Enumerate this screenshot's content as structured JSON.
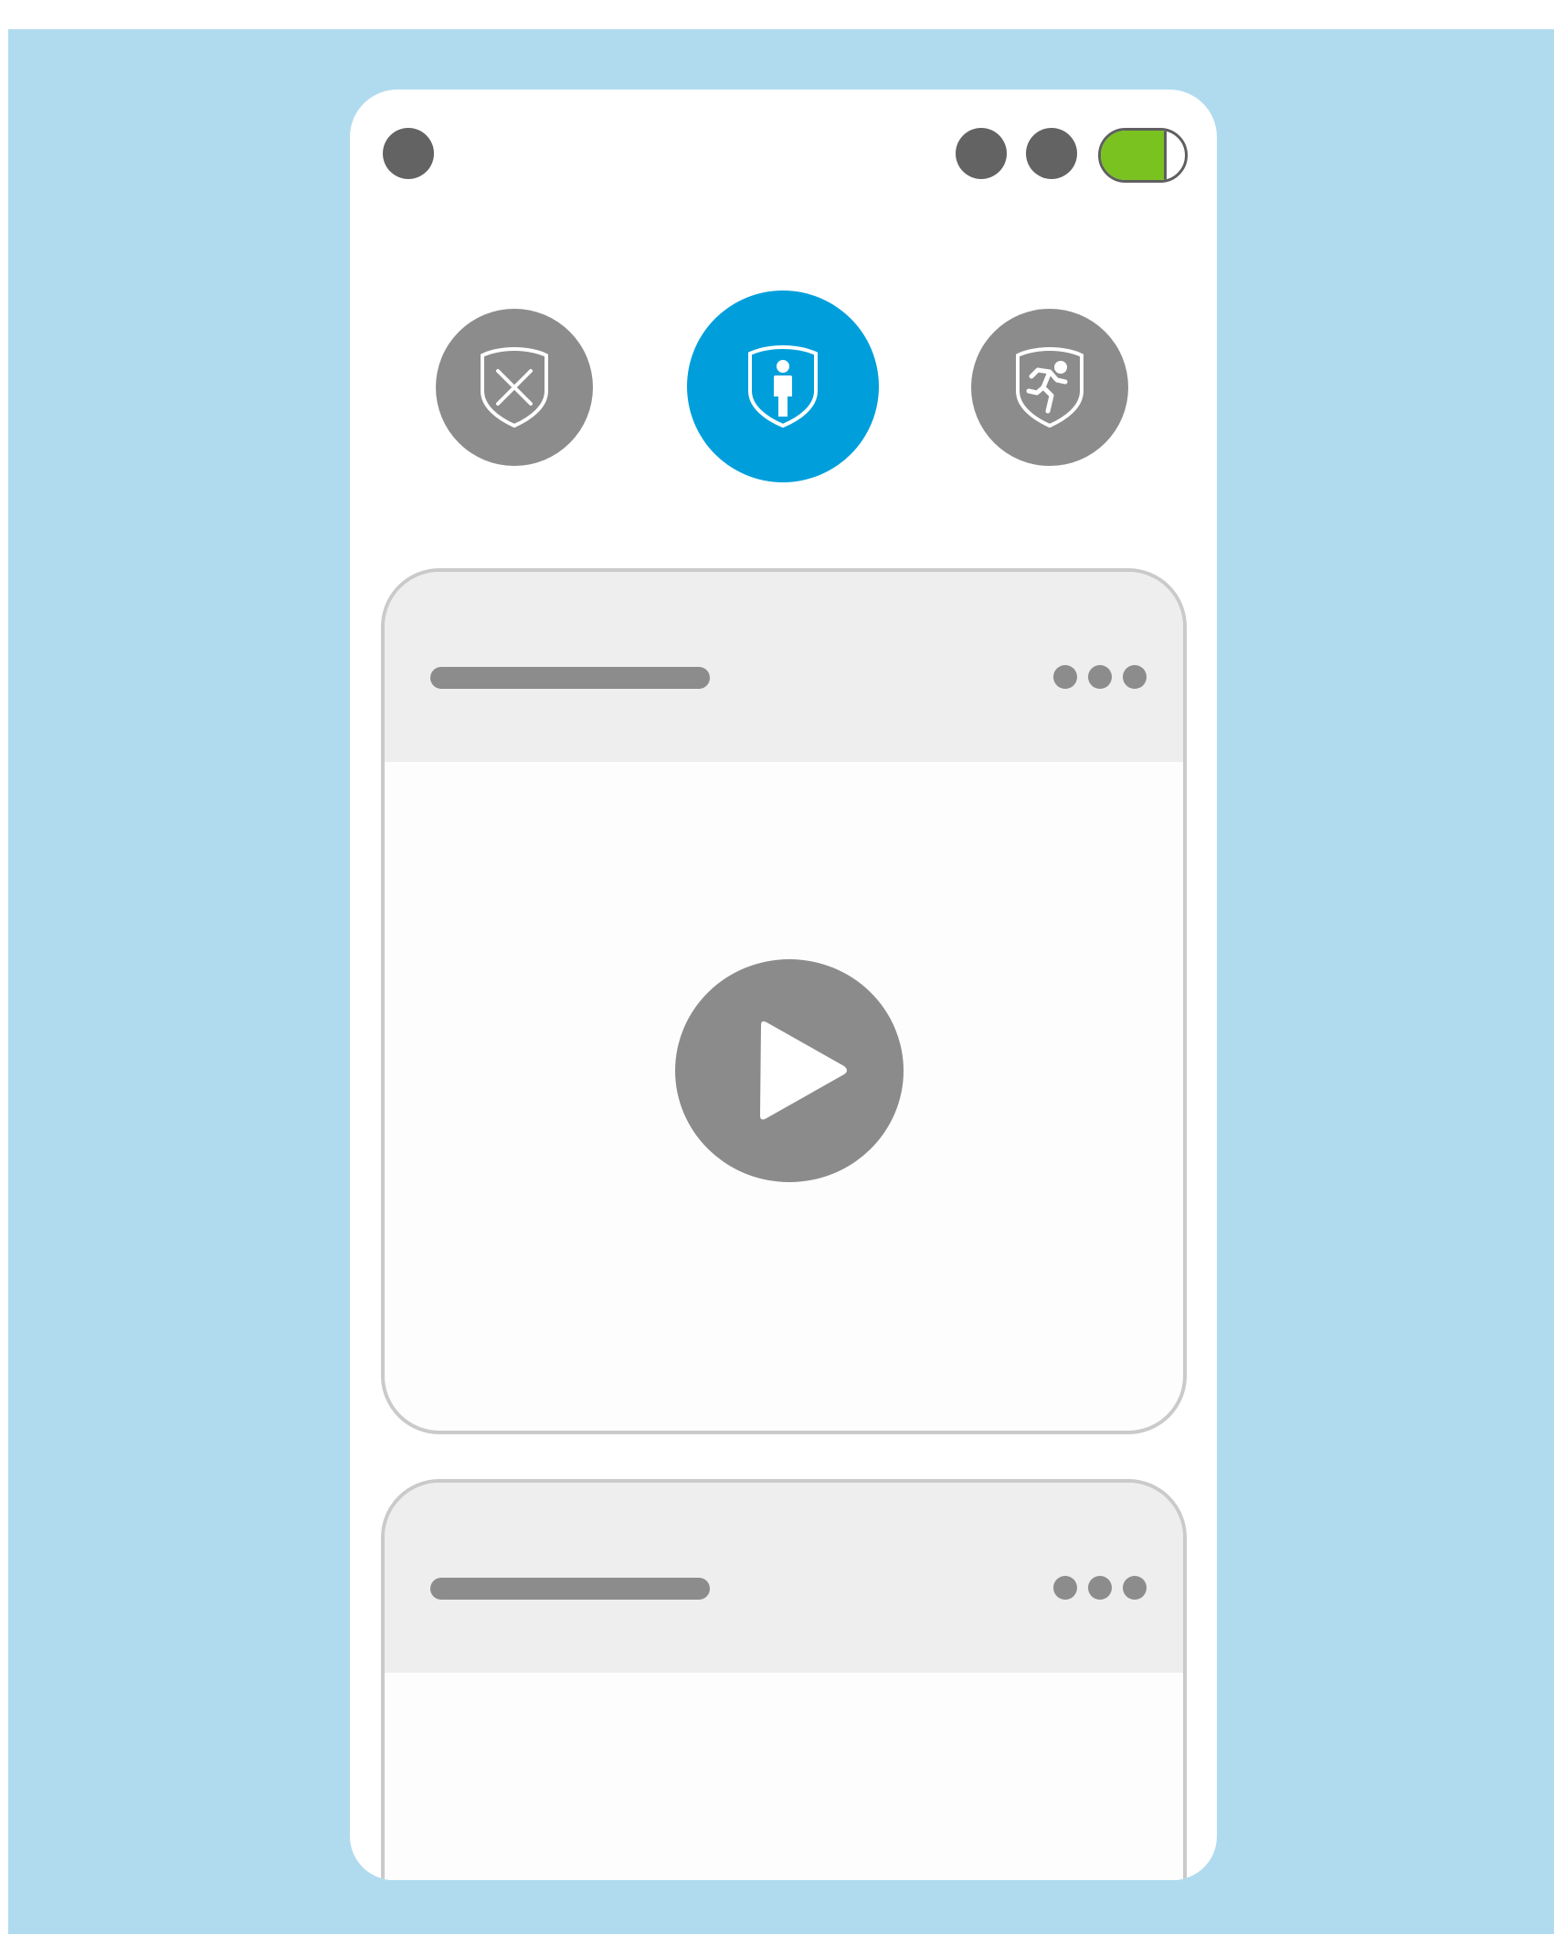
{
  "status_bar": {
    "battery_level_percent": 75,
    "battery_color": "#79c21f",
    "indicators": [
      "status-dot",
      "status-dot",
      "status-dot"
    ]
  },
  "modes": [
    {
      "name": "disarmed",
      "icon": "shield-x-icon",
      "selected": false,
      "color": "#8c8c8c"
    },
    {
      "name": "home",
      "icon": "shield-person-icon",
      "selected": true,
      "color": "#009fdb"
    },
    {
      "name": "away",
      "icon": "shield-running-person-icon",
      "selected": false,
      "color": "#8c8c8c"
    }
  ],
  "cards": [
    {
      "title_placeholder": "",
      "menu_icon": "more-dots-icon",
      "media_icon": "play-icon"
    },
    {
      "title_placeholder": "",
      "menu_icon": "more-dots-icon"
    }
  ],
  "colors": {
    "backdrop": "#b0dbef",
    "accent": "#009fdb",
    "inactive": "#8c8c8c"
  }
}
